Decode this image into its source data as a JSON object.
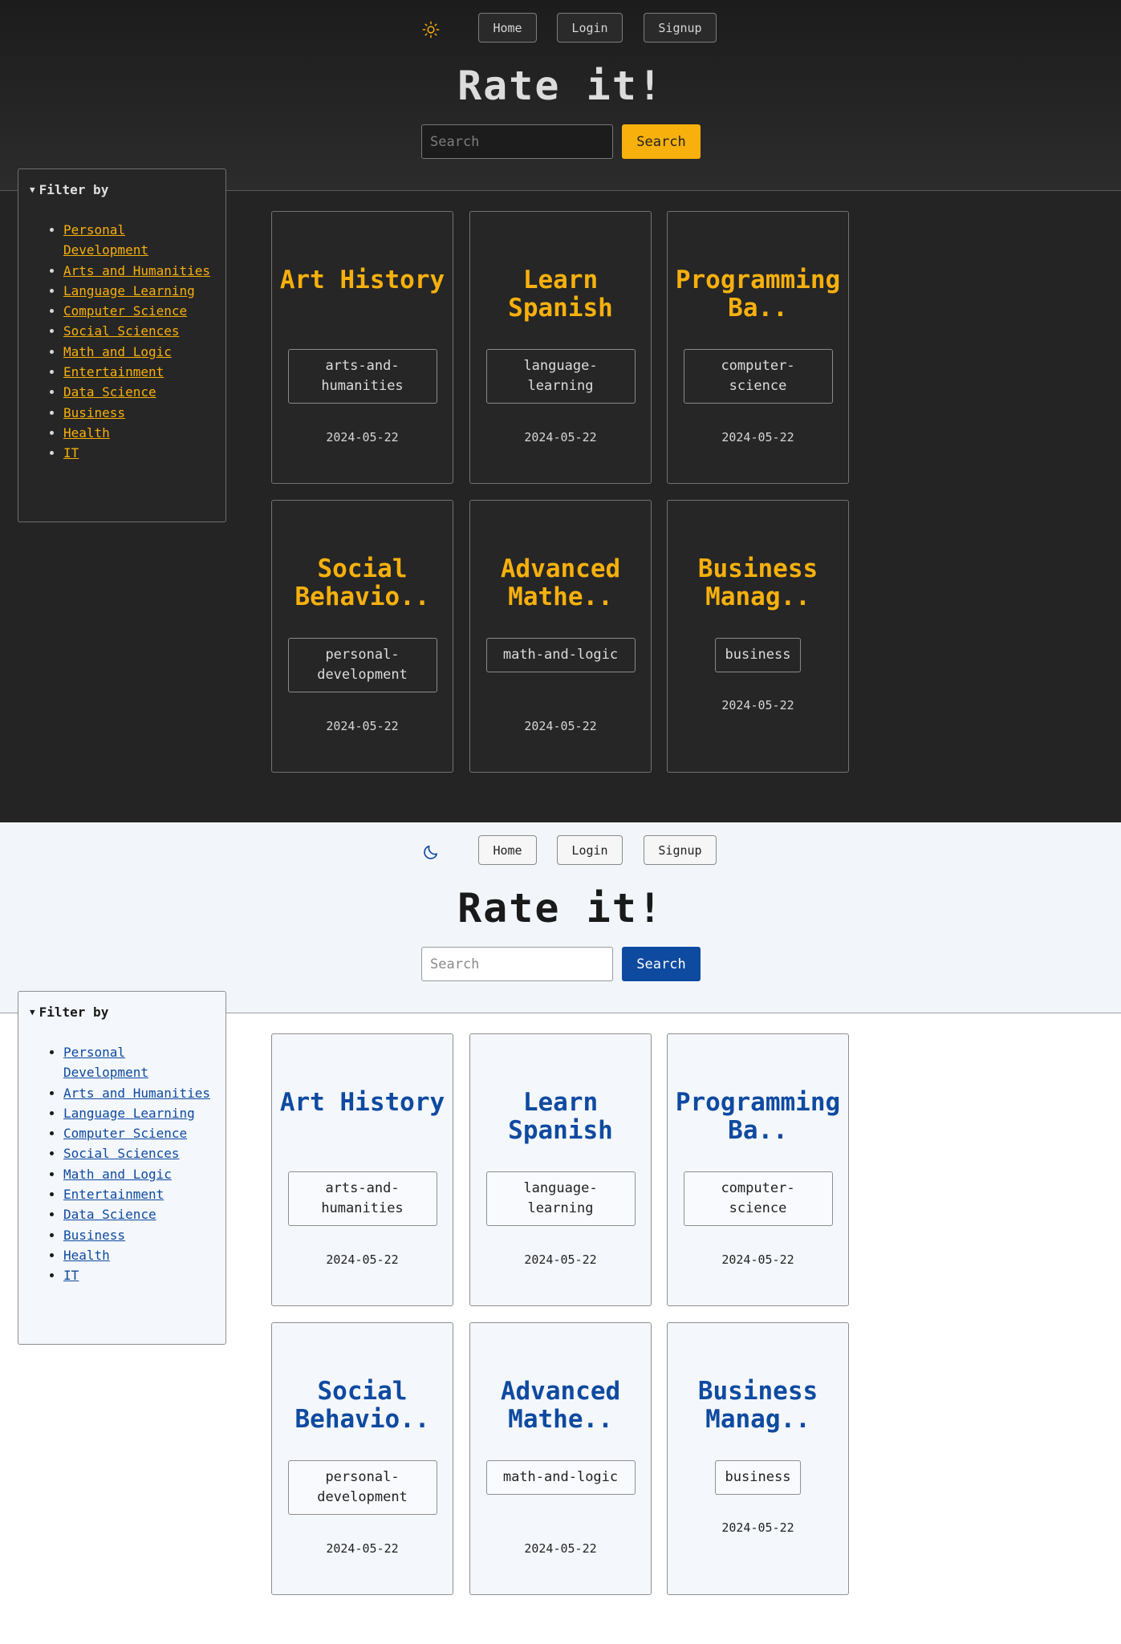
{
  "nav": {
    "home": "Home",
    "login": "Login",
    "signup": "Signup"
  },
  "title": "Rate it!",
  "search": {
    "placeholder": "Search",
    "button": "Search"
  },
  "filter": {
    "summary": "Filter by",
    "items": [
      "Personal Development",
      "Arts and Humanities",
      "Language Learning",
      "Computer Science",
      "Social Sciences",
      "Math and Logic",
      "Entertainment",
      "Data Science",
      "Business",
      "Health",
      "IT"
    ]
  },
  "cards": [
    {
      "title": "Art History",
      "tag": "arts-and-humanities",
      "date": "2024-05-22"
    },
    {
      "title": "Learn Spanish",
      "tag": "language-learning",
      "date": "2024-05-22"
    },
    {
      "title": "Programming Ba..",
      "tag": "computer-science",
      "date": "2024-05-22"
    },
    {
      "title": "Social Behavio..",
      "tag": "personal-development",
      "date": "2024-05-22"
    },
    {
      "title": "Advanced Mathe..",
      "tag": "math-and-logic",
      "date": "2024-05-22"
    },
    {
      "title": "Business Manag..",
      "tag": "business",
      "date": "2024-05-22"
    }
  ],
  "themes": {
    "dark": {
      "accent": "#f7b00c",
      "icon": "sun-icon"
    },
    "light": {
      "accent": "#0e4aa0",
      "icon": "moon-icon"
    }
  }
}
